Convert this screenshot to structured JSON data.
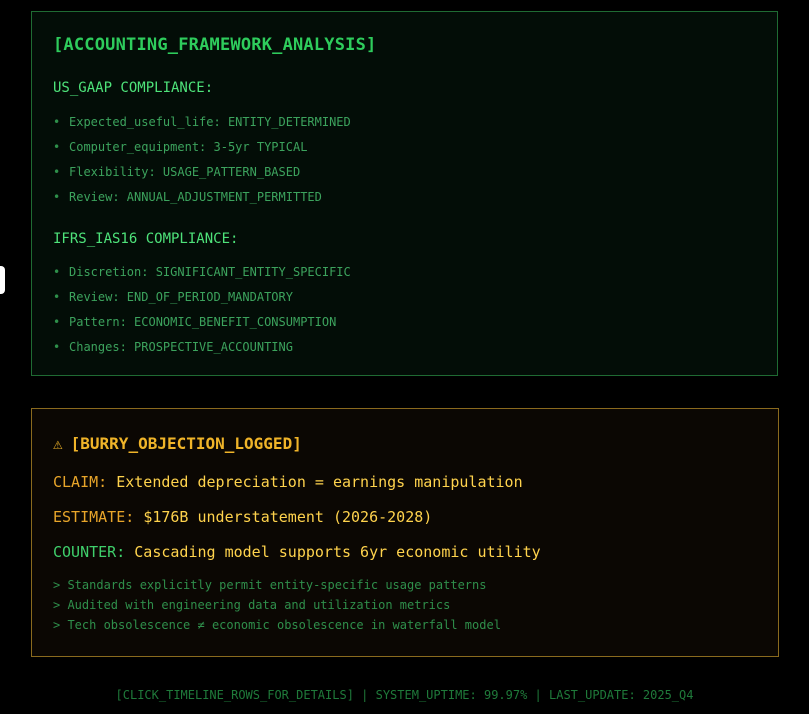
{
  "framework": {
    "title": "[ACCOUNTING_FRAMEWORK_ANALYSIS]",
    "sections": [
      {
        "heading": "US_GAAP COMPLIANCE:",
        "items": [
          "Expected_useful_life: ENTITY_DETERMINED",
          "Computer_equipment: 3-5yr TYPICAL",
          "Flexibility: USAGE_PATTERN_BASED",
          "Review: ANNUAL_ADJUSTMENT_PERMITTED"
        ]
      },
      {
        "heading": "IFRS_IAS16 COMPLIANCE:",
        "items": [
          "Discretion: SIGNIFICANT_ENTITY_SPECIFIC",
          "Review: END_OF_PERIOD_MANDATORY",
          "Pattern: ECONOMIC_BENEFIT_CONSUMPTION",
          "Changes: PROSPECTIVE_ACCOUNTING"
        ]
      }
    ],
    "bullet": "•"
  },
  "objection": {
    "icon": "warning-icon",
    "icon_glyph": "⚠",
    "title": "[BURRY_OBJECTION_LOGGED]",
    "claim_label": "CLAIM:",
    "claim_value": "Extended depreciation = earnings manipulation",
    "estimate_label": "ESTIMATE:",
    "estimate_value": "$176B understatement (2026-2028)",
    "counter_label": "COUNTER:",
    "counter_value": "Cascading model supports 6yr economic utility",
    "notes": [
      "> Standards explicitly permit entity-specific usage patterns",
      "> Audited with engineering data and utilization metrics",
      "> Tech obsolescence ≠ economic obsolescence in waterfall model"
    ]
  },
  "footer": {
    "text": "[CLICK_TIMELINE_ROWS_FOR_DETAILS] | SYSTEM_UPTIME: 99.97% | LAST_UPDATE: 2025_Q4"
  },
  "colors": {
    "background": "#000000",
    "green_accent": "#2ecc5c",
    "amber_accent": "#f0b429"
  }
}
